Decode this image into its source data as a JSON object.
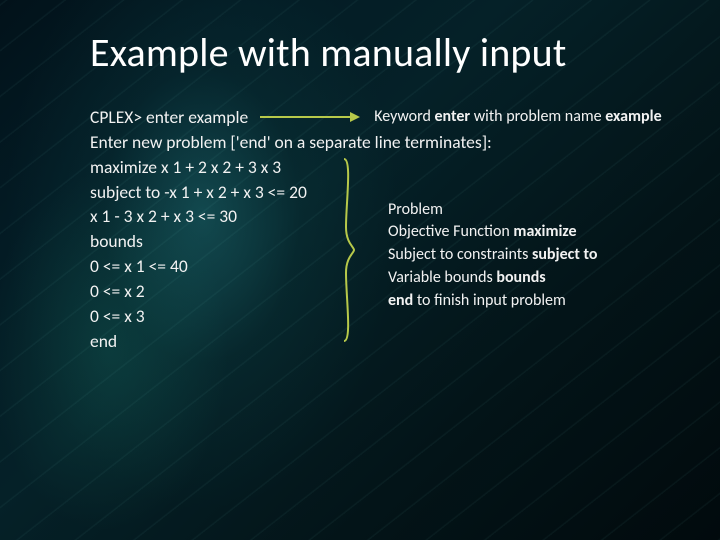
{
  "title": "Example with manually input",
  "line1": {
    "prompt": "CPLEX> enter example",
    "note_prefix": "Keyword ",
    "note_kw1": "enter",
    "note_mid": " with problem name ",
    "note_kw2": "example"
  },
  "lines": {
    "l2": "Enter new problem ['end' on a separate line terminates]:",
    "l3": "maximize x 1 + 2 x 2 + 3 x 3",
    "l4": "subject to -x 1 + x 2 + x 3 <= 20",
    "l5": "x 1 - 3 x 2 + x 3 <= 30",
    "l6": "bounds",
    "l7": "0 <= x 1 <= 40",
    "l8": "0 <= x 2",
    "l9": "0 <= x 3",
    "l10": "end"
  },
  "note": {
    "r1": "Problem",
    "r2a": "Objective Function  ",
    "r2b": "maximize",
    "r3a": "Subject to constraints ",
    "r3b": "subject to",
    "r4a": "Variable bounds ",
    "r4b": "bounds",
    "r5a": "end",
    "r5b": " to finish input problem"
  },
  "colors": {
    "accent": "#b7c94a"
  }
}
